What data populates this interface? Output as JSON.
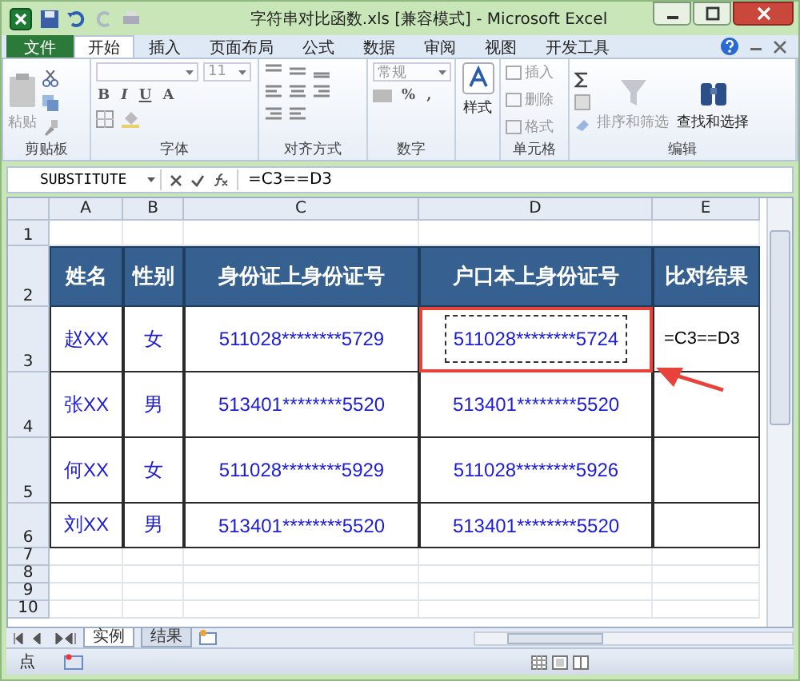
{
  "window": {
    "title": "字符串对比函数.xls  [兼容模式]  -  Microsoft Excel"
  },
  "tabs": [
    {
      "label": "文件",
      "kind": "file",
      "selected": false
    },
    {
      "label": "开始",
      "kind": "tab",
      "selected": true
    },
    {
      "label": "插入",
      "kind": "tab",
      "selected": false
    },
    {
      "label": "页面布局",
      "kind": "tab",
      "selected": false
    },
    {
      "label": "公式",
      "kind": "tab",
      "selected": false
    },
    {
      "label": "数据",
      "kind": "tab",
      "selected": false
    },
    {
      "label": "审阅",
      "kind": "tab",
      "selected": false
    },
    {
      "label": "视图",
      "kind": "tab",
      "selected": false
    },
    {
      "label": "开发工具",
      "kind": "tab",
      "selected": false
    }
  ],
  "ribbon": {
    "clipboard": {
      "label": "剪贴板",
      "paste": {
        "label": "粘贴",
        "disabled": true
      }
    },
    "font": {
      "label": "字体",
      "size": "11",
      "bold": "B",
      "italic": "I",
      "underline": "U",
      "color_letter": "A"
    },
    "alignment": {
      "label": "对齐方式"
    },
    "number": {
      "label": "数字",
      "format": "常规",
      "percent": "%",
      "comma": ","
    },
    "styles": {
      "button": "样式"
    },
    "cells": {
      "label": "单元格",
      "items": [
        {
          "label": "插入",
          "disabled": true
        },
        {
          "label": "删除",
          "disabled": true
        },
        {
          "label": "格式",
          "disabled": true
        }
      ]
    },
    "editing": {
      "label": "编辑",
      "items": [
        {
          "label": "排序和筛选",
          "disabled": true
        },
        {
          "label": "查找和选择",
          "disabled": false
        }
      ]
    }
  },
  "formula_bar": {
    "name_box": "SUBSTITUTE",
    "formula": "=C3==D3"
  },
  "sheet": {
    "columns": [
      "A",
      "B",
      "C",
      "D",
      "E"
    ],
    "rows": [
      {
        "number": "1",
        "kind": "empty"
      },
      {
        "number": "2",
        "kind": "header",
        "cells": [
          "姓名",
          "性别",
          "身份证上身份证号",
          "户口本上身份证号",
          "比对结果"
        ]
      },
      {
        "number": "3",
        "kind": "data",
        "cells": [
          "赵XX",
          "女",
          "511028********5729",
          "511028********5724",
          "=C3==D3"
        ],
        "highlighted": true
      },
      {
        "number": "4",
        "kind": "data",
        "cells": [
          "张XX",
          "男",
          "513401********5520",
          "513401********5520",
          ""
        ],
        "highlighted": false
      },
      {
        "number": "5",
        "kind": "data",
        "cells": [
          "何XX",
          "女",
          "511028********5929",
          "511028********5926",
          ""
        ],
        "highlighted": false
      },
      {
        "number": "6",
        "kind": "data",
        "cells": [
          "刘XX",
          "男",
          "513401********5520",
          "513401********5520",
          ""
        ],
        "highlighted": false
      },
      {
        "number": "7",
        "kind": "empty"
      },
      {
        "number": "8",
        "kind": "empty"
      },
      {
        "number": "9",
        "kind": "empty"
      },
      {
        "number": "10",
        "kind": "empty"
      }
    ]
  },
  "sheet_tabs": [
    {
      "label": "实例",
      "selected": true
    },
    {
      "label": "结果",
      "selected": false
    }
  ],
  "status_bar": {
    "mode": "点"
  }
}
